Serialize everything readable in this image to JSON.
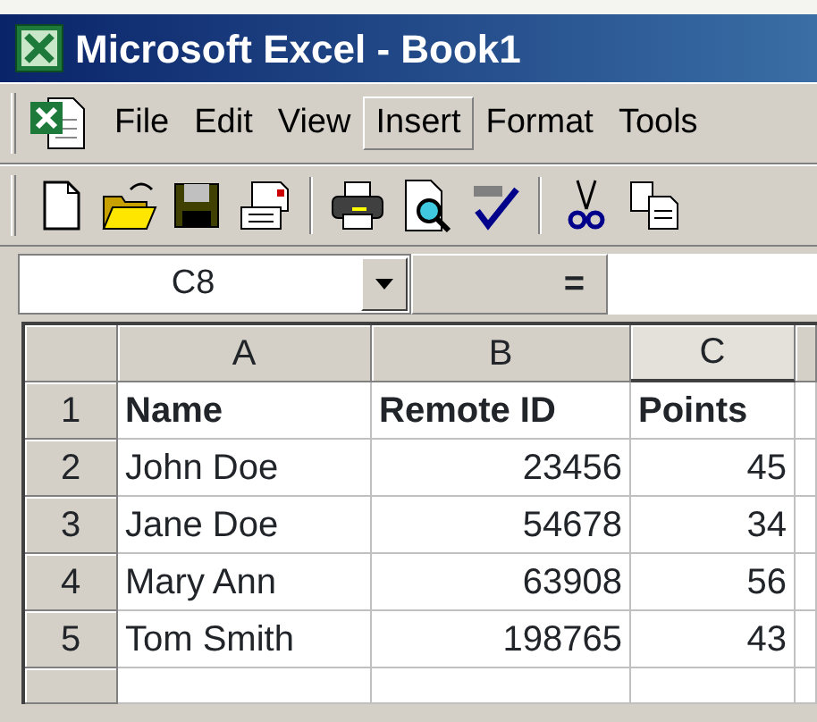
{
  "window": {
    "title": "Microsoft Excel - Book1"
  },
  "menu": [
    {
      "label": "File",
      "selected": false
    },
    {
      "label": "Edit",
      "selected": false
    },
    {
      "label": "View",
      "selected": false
    },
    {
      "label": "Insert",
      "selected": true
    },
    {
      "label": "Format",
      "selected": false
    },
    {
      "label": "Tools",
      "selected": false
    }
  ],
  "toolbar": [
    {
      "kind": "new"
    },
    {
      "kind": "open"
    },
    {
      "kind": "save"
    },
    {
      "kind": "mail"
    },
    {
      "kind": "sep"
    },
    {
      "kind": "print"
    },
    {
      "kind": "preview"
    },
    {
      "kind": "spell"
    },
    {
      "kind": "sep"
    },
    {
      "kind": "cut"
    },
    {
      "kind": "copy"
    }
  ],
  "formula_bar": {
    "name_box": "C8",
    "equals": "="
  },
  "columns": [
    {
      "label": "A",
      "selected": false
    },
    {
      "label": "B",
      "selected": false
    },
    {
      "label": "C",
      "selected": true
    }
  ],
  "rows": [
    {
      "header": "1",
      "bold": true,
      "cells": [
        {
          "text": "Name",
          "kind": "text"
        },
        {
          "text": "Remote ID",
          "kind": "text"
        },
        {
          "text": "Points",
          "kind": "text"
        }
      ]
    },
    {
      "header": "2",
      "bold": false,
      "cells": [
        {
          "text": "John Doe",
          "kind": "text"
        },
        {
          "text": "23456",
          "kind": "number"
        },
        {
          "text": "45",
          "kind": "number"
        }
      ]
    },
    {
      "header": "3",
      "bold": false,
      "cells": [
        {
          "text": "Jane Doe",
          "kind": "text"
        },
        {
          "text": "54678",
          "kind": "number"
        },
        {
          "text": "34",
          "kind": "number"
        }
      ]
    },
    {
      "header": "4",
      "bold": false,
      "cells": [
        {
          "text": "Mary Ann",
          "kind": "text"
        },
        {
          "text": "63908",
          "kind": "number"
        },
        {
          "text": "56",
          "kind": "number"
        }
      ]
    },
    {
      "header": "5",
      "bold": false,
      "cells": [
        {
          "text": "Tom Smith",
          "kind": "text"
        },
        {
          "text": "198765",
          "kind": "number"
        },
        {
          "text": "43",
          "kind": "number"
        }
      ]
    }
  ]
}
